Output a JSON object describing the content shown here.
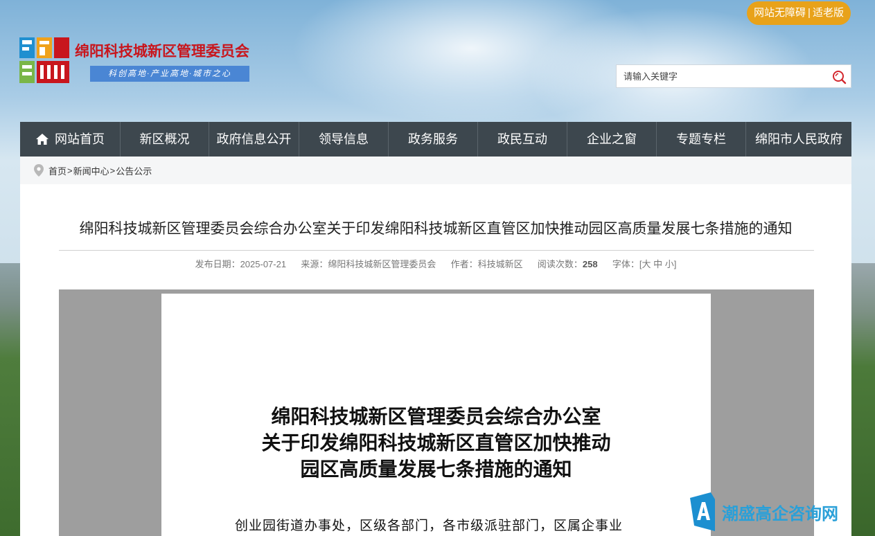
{
  "header": {
    "accessibility_label": "网站无障碍",
    "divider": "|",
    "elderly_label": "适老版",
    "site_title": "绵阳科技城新区管理委员会",
    "slogan": "科创高地·产业高地·城市之心",
    "logo_icon": "sgm-logo-icon"
  },
  "search": {
    "placeholder": "请输入关键字",
    "icon": "search-icon"
  },
  "nav": {
    "items": [
      {
        "label": "网站首页",
        "icon": "home-icon"
      },
      {
        "label": "新区概况"
      },
      {
        "label": "政府信息公开"
      },
      {
        "label": "领导信息"
      },
      {
        "label": "政务服务"
      },
      {
        "label": "政民互动"
      },
      {
        "label": "企业之窗"
      },
      {
        "label": "专题专栏"
      },
      {
        "label": "绵阳市人民政府"
      }
    ]
  },
  "breadcrumb": {
    "home": "首页",
    "section": "新闻中心",
    "current": "公告公示",
    "separator": ">"
  },
  "article": {
    "title": "绵阳科技城新区管理委员会综合办公室关于印发绵阳科技城新区直管区加快推动园区高质量发展七条措施的通知",
    "date_label": "发布日期：",
    "date": "2025-07-21",
    "source_label": "来源：",
    "source": "绵阳科技城新区管理委员会",
    "author_label": "作者：",
    "author": "科技城新区",
    "reads_label": "阅读次数：",
    "reads": "258",
    "font_label": "字体：",
    "font_open": "[",
    "font_large": "大",
    "font_medium": "中",
    "font_small": "小",
    "font_close": "]"
  },
  "document": {
    "title_line1": "绵阳科技城新区管理委员会综合办公室",
    "title_line2": "关于印发绵阳科技城新区直管区加快推动",
    "title_line3": "园区高质量发展七条措施的通知",
    "body_line1": "创业园街道办事处，区级各部门，各市级派驻部门，区属企事业"
  },
  "watermark": {
    "text": "潮盛高企咨询网"
  },
  "colors": {
    "nav_bg": "#3d474e",
    "title_red": "#c8161d",
    "a11y_orange": "#e8a21a",
    "slogan_blue": "#4a86d4",
    "watermark_blue": "#2aa0d8"
  }
}
